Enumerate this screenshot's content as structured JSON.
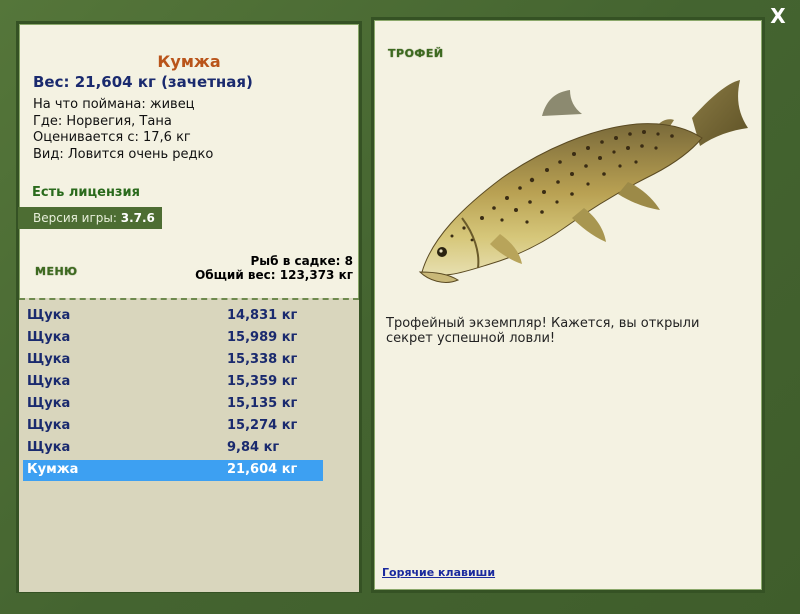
{
  "window": {
    "close_label": "X"
  },
  "fish": {
    "name": "Кумжа",
    "weight_line": "Вес: 21,604 кг (зачетная)",
    "bait_line": "На что поймана: живец",
    "place_line": "Где: Норвегия, Тана",
    "rated_line": "Оценивается с: 17,6 кг",
    "kind_line": "Вид: Ловится очень редко"
  },
  "license_text": "Есть лицензия",
  "version": {
    "label": "Версия игры:",
    "value": "3.7.6"
  },
  "menu_label": "МЕНЮ",
  "keepnet": {
    "count_line": "Рыб в садке: 8",
    "total_line": "Общий вес: 123,373 кг"
  },
  "catches": [
    {
      "name": "Щука",
      "weight": "14,831 кг"
    },
    {
      "name": "Щука",
      "weight": "15,989 кг"
    },
    {
      "name": "Щука",
      "weight": "15,338 кг"
    },
    {
      "name": "Щука",
      "weight": "15,359 кг"
    },
    {
      "name": "Щука",
      "weight": "15,135 кг"
    },
    {
      "name": "Щука",
      "weight": "15,274 кг"
    },
    {
      "name": "Щука",
      "weight": "9,84 кг"
    },
    {
      "name": "Кумжа",
      "weight": "21,604 кг",
      "selected": true
    }
  ],
  "trophy": {
    "title": "ТРОФЕЙ",
    "message": "Трофейный экземпляр! Кажется, вы открыли секрет успешной ловли!",
    "image_icon": "brown-trout-image"
  },
  "hotkeys_label": "Горячие клавиши",
  "colors": {
    "frame": "#4a6a30",
    "panel": "#f4f2e2",
    "selection": "#3da0f2",
    "fish_name": "#b9541a"
  }
}
